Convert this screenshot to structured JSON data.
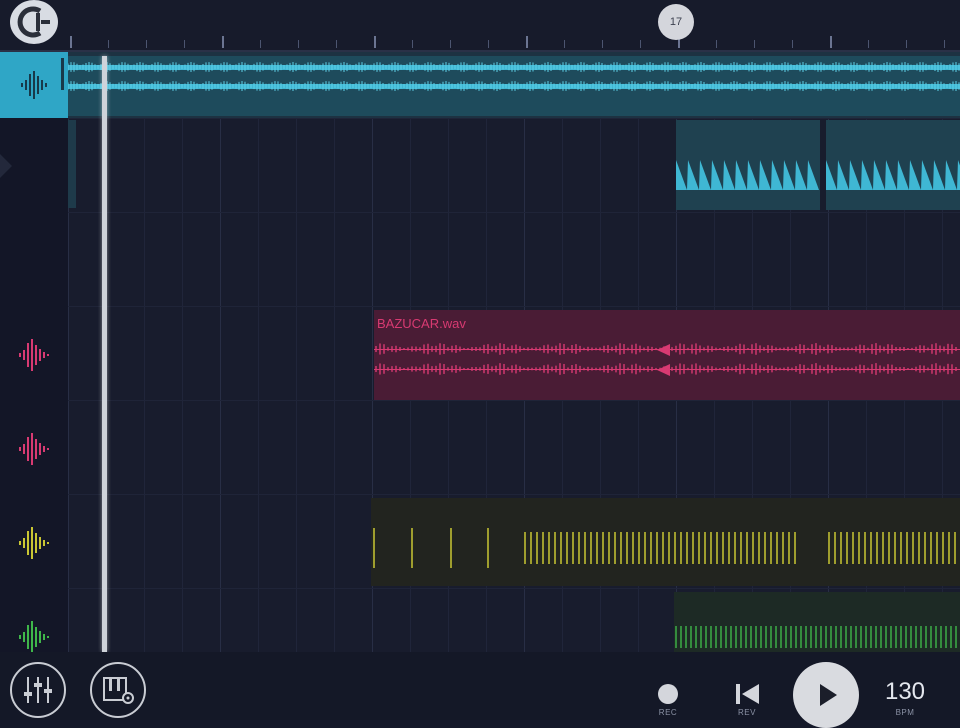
{
  "app": {
    "logo_icon": "fl-studio-mobile-logo"
  },
  "timeline": {
    "marker_label": "17"
  },
  "tracks": [
    {
      "icon": "waveform-icon",
      "color": "#2fa6c6",
      "selected": true
    },
    {
      "icon": "waveform-icon",
      "color": "#2fa6c6",
      "selected": false
    },
    {
      "icon": "waveform-icon",
      "color": "#3a3f55",
      "selected": false
    },
    {
      "icon": "waveform-icon",
      "color": "#d83a72",
      "selected": false
    },
    {
      "icon": "waveform-icon",
      "color": "#d83a72",
      "selected": false
    },
    {
      "icon": "waveform-icon",
      "color": "#c9c633",
      "selected": false
    },
    {
      "icon": "waveform-icon",
      "color": "#3fb64a",
      "selected": false
    }
  ],
  "clips": {
    "sample_name": "BAZUCAR.wav"
  },
  "transport": {
    "rec_label": "REC",
    "rev_label": "REV",
    "bpm_value": "130",
    "bpm_label": "BPM"
  },
  "colors": {
    "cyan": "#2fa6c6",
    "pink": "#d83a72",
    "yellow": "#c9c633",
    "green": "#3fb64a"
  }
}
